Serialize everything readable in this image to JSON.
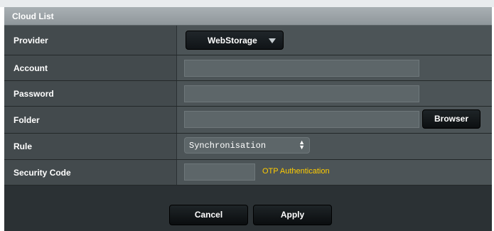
{
  "panel": {
    "title": "Cloud List"
  },
  "form": {
    "provider": {
      "label": "Provider",
      "value": "WebStorage"
    },
    "account": {
      "label": "Account",
      "value": ""
    },
    "password": {
      "label": "Password",
      "value": ""
    },
    "folder": {
      "label": "Folder",
      "value": "",
      "browse_label": "Browser"
    },
    "rule": {
      "label": "Rule",
      "value": "Synchronisation"
    },
    "security_code": {
      "label": "Security Code",
      "value": "",
      "hint": "OTP Authentication"
    }
  },
  "buttons": {
    "cancel": "Cancel",
    "apply": "Apply"
  },
  "colors": {
    "accent_hint": "#ffcc00",
    "panel_bg": "#2b3134"
  }
}
